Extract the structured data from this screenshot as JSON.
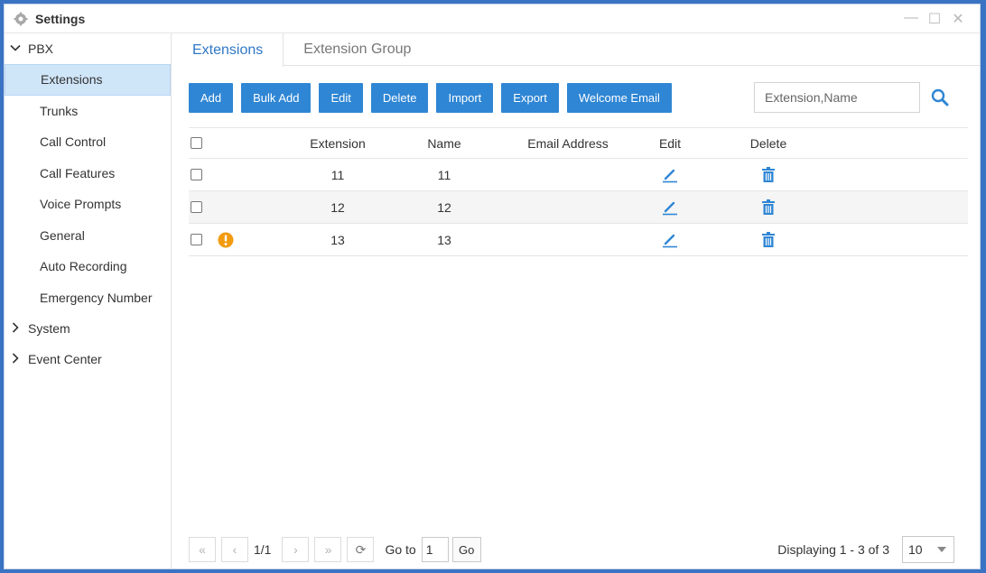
{
  "window": {
    "title": "Settings"
  },
  "sidebar": {
    "pbx_label": "PBX",
    "items": [
      {
        "label": "Extensions",
        "active": true
      },
      {
        "label": "Trunks"
      },
      {
        "label": "Call Control"
      },
      {
        "label": "Call Features"
      },
      {
        "label": "Voice Prompts"
      },
      {
        "label": "General"
      },
      {
        "label": "Auto Recording"
      },
      {
        "label": "Emergency Number"
      }
    ],
    "system_label": "System",
    "event_center_label": "Event Center"
  },
  "tabs": [
    {
      "label": "Extensions",
      "active": true
    },
    {
      "label": "Extension Group"
    }
  ],
  "toolbar": {
    "add": "Add",
    "bulk_add": "Bulk Add",
    "edit": "Edit",
    "delete": "Delete",
    "import": "Import",
    "export": "Export",
    "welcome_email": "Welcome Email"
  },
  "search": {
    "placeholder": "Extension,Name",
    "value": ""
  },
  "table": {
    "columns": {
      "extension": "Extension",
      "name": "Name",
      "email": "Email Address",
      "edit": "Edit",
      "delete": "Delete"
    },
    "rows": [
      {
        "extension": "11",
        "name": "11",
        "email": "",
        "warning": false
      },
      {
        "extension": "12",
        "name": "12",
        "email": "",
        "warning": false
      },
      {
        "extension": "13",
        "name": "13",
        "email": "",
        "warning": true
      }
    ]
  },
  "pager": {
    "page_info": "1/1",
    "goto_label": "Go to",
    "goto_value": "1",
    "go_label": "Go",
    "displaying": "Displaying 1 - 3 of 3",
    "page_size": "10"
  },
  "colors": {
    "accent": "#2f86d4",
    "warning": "#f39c12",
    "active_bg": "#cfe5f8"
  }
}
